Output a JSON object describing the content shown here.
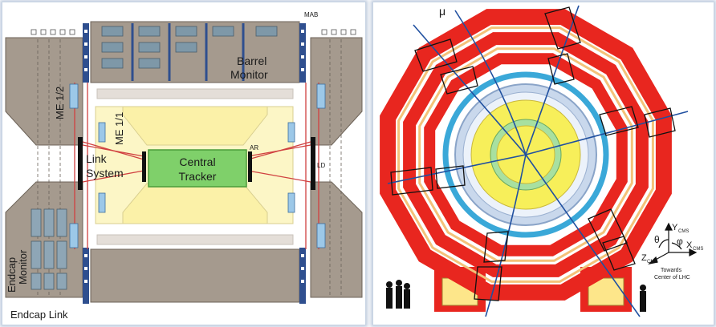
{
  "left_diagram": {
    "labels": {
      "mab": "MAB",
      "barrel_monitor_line1": "Barrel",
      "barrel_monitor_line2": "Monitor",
      "me12": "ME 1/2",
      "me11": "ME 1/1",
      "central_tracker_line1": "Central",
      "central_tracker_line2": "Tracker",
      "ar": "AR",
      "ld": "LD",
      "link_system_line1": "Link",
      "link_system_line2": "System",
      "endcap_monitor_line1": "Endcap",
      "endcap_monitor_line2": "Monitor",
      "endcap_link": "Endcap Link"
    },
    "colors": {
      "chamber": "#a59a8e",
      "tracker": "#7fd06a",
      "tracker_border": "#4b9c3a",
      "yellow": "#fcf6c6",
      "laser_line": "#d04040",
      "mab_blue": "#2f4f8f",
      "sensor_blue": "#9cc8e8"
    }
  },
  "right_diagram": {
    "labels": {
      "mu": "μ",
      "theta": "θ",
      "phi": "φ",
      "y_axis": "Y",
      "y_sub": "CMS",
      "x_axis": "X",
      "x_sub": "CMS",
      "z_axis": "Z",
      "z_sub": "CMS",
      "towards_line1": "Towards",
      "towards_line2": "Center of LHC"
    },
    "colors": {
      "return_yoke": "#e8261f",
      "muon_chamber": "#f4c27a",
      "solenoid": "#3aa8d8",
      "calorimeter": "#f7ef5a",
      "tracker_ring": "#a8e0a0",
      "track": "#2050a0"
    }
  }
}
